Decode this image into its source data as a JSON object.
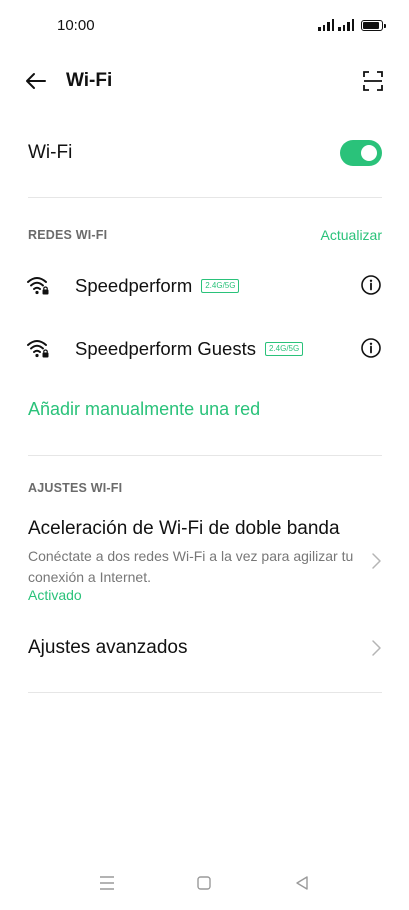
{
  "status_bar": {
    "time": "10:00",
    "icons": [
      "signal-icon",
      "signal-icon",
      "battery-icon"
    ]
  },
  "app_bar": {
    "title": "Wi-Fi",
    "icons": [
      "back-arrow-icon",
      "scan-qr-icon"
    ]
  },
  "wifi_toggle": {
    "label": "Wi-Fi",
    "state": "on"
  },
  "networks_section": {
    "header": "REDES WI-FI",
    "refresh_label": "Actualizar",
    "networks": [
      {
        "name": "Speedperform",
        "band": "2.4G/5G",
        "icon": "wifi-locked-icon",
        "action_icon": "info-icon"
      },
      {
        "name": "Speedperform Guests",
        "band": "2.4G/5G",
        "icon": "wifi-locked-icon",
        "action_icon": "info-icon"
      }
    ],
    "add_network_label": "Añadir manualmente una red"
  },
  "settings_section": {
    "header": "AJUSTES WI-FI",
    "dual_band": {
      "title": "Aceleración de Wi-Fi de doble banda",
      "description": "Conéctate a dos redes Wi-Fi a la vez para agilizar tu conexión a Internet.",
      "status": "Activado"
    },
    "advanced": {
      "label": "Ajustes avanzados"
    }
  },
  "nav_bar": {
    "icons": [
      "menu-icon",
      "home-icon",
      "back-icon"
    ]
  },
  "colors": {
    "accent": "#2ac27a",
    "text": "#111111",
    "secondary_text": "#777777",
    "divider": "#e6e6e6"
  }
}
